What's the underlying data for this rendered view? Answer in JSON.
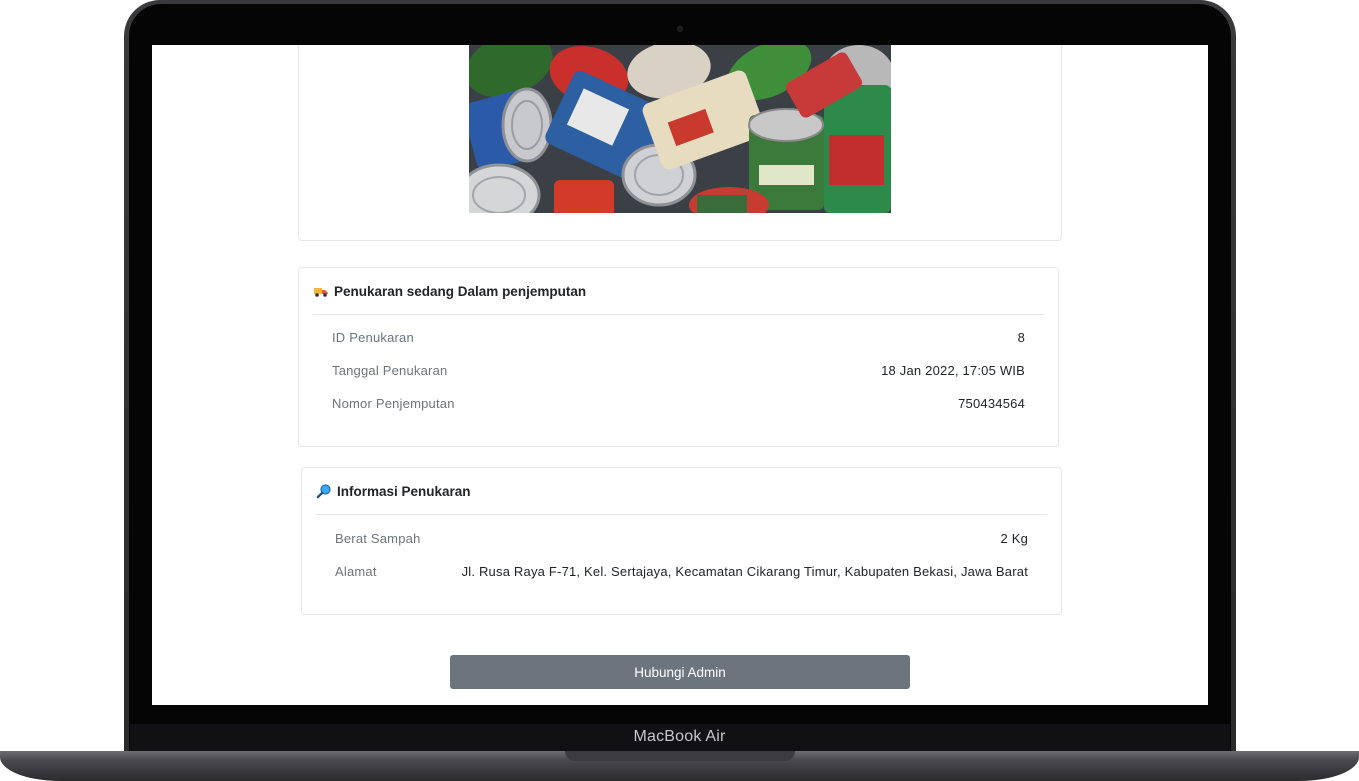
{
  "device": {
    "model_label": "MacBook Air"
  },
  "hero_image": {
    "subject": "pile of canned food tins"
  },
  "status_card": {
    "icon": "delivery-truck-icon",
    "title": "Penukaran sedang Dalam penjemputan",
    "rows": [
      {
        "label": "ID Penukaran",
        "value": "8"
      },
      {
        "label": "Tanggal Penukaran",
        "value": "18 Jan 2022, 17:05 WIB"
      },
      {
        "label": "Nomor Penjemputan",
        "value": "750434564"
      }
    ]
  },
  "info_card": {
    "icon": "magnifying-glass-icon",
    "title": "Informasi Penukaran",
    "rows": [
      {
        "label": "Berat Sampah",
        "value": "2 Kg"
      },
      {
        "label": "Alamat",
        "value": "Jl. Rusa Raya F-71, Kel. Sertajaya, Kecamatan Cikarang Timur, Kabupaten Bekasi, Jawa Barat"
      }
    ]
  },
  "actions": {
    "contact_admin_label": "Hubungi Admin"
  },
  "colors": {
    "button_bg": "#6c757d",
    "text": "#212529",
    "muted": "#6c757d",
    "border": "#e6e6e6"
  }
}
